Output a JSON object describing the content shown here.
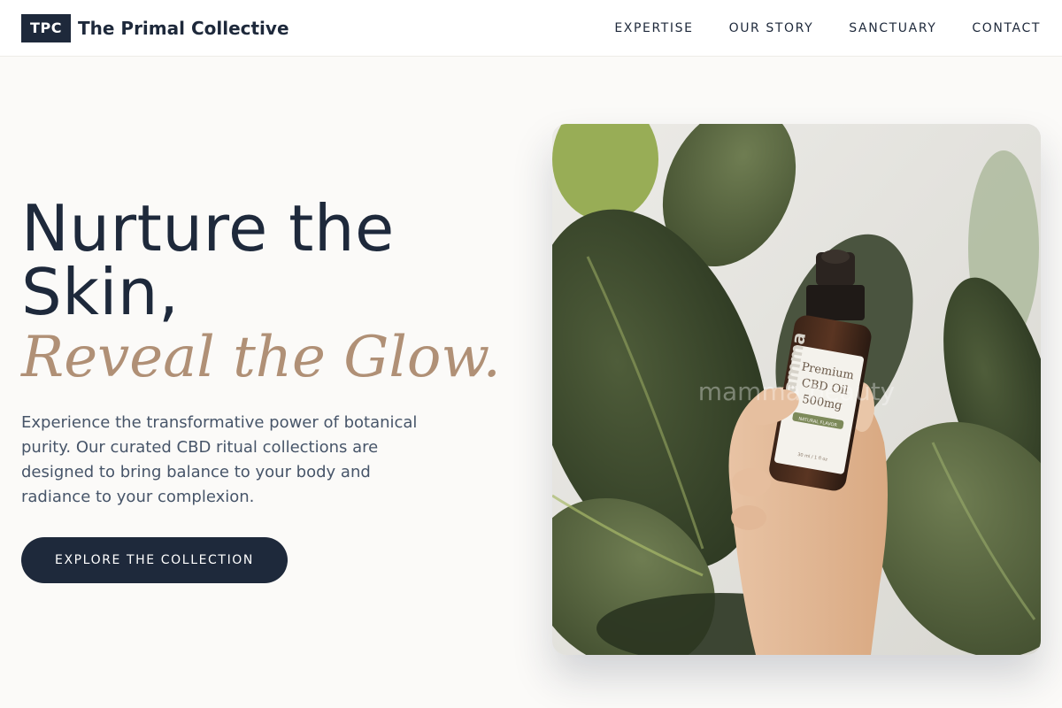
{
  "header": {
    "logo_text": "TPC",
    "brand_name": "The Primal Collective",
    "nav": [
      {
        "label": "EXPERTISE"
      },
      {
        "label": "OUR STORY"
      },
      {
        "label": "SANCTUARY"
      },
      {
        "label": "CONTACT"
      }
    ]
  },
  "hero": {
    "title_line1": "Nurture the",
    "title_line2": "Skin,",
    "accent": "Reveal the Glow.",
    "description": "Experience the transformative power of botanical purity. Our curated CBD ritual collections are designed to bring balance to your body and radiance to your complexion.",
    "cta_label": "EXPLORE THE COLLECTION"
  },
  "image": {
    "bottle_label_line1": "Premium",
    "bottle_label_line2": "CBD Oil",
    "bottle_label_line3": "500mg",
    "bottle_tag": "NATURAL FLAVOR",
    "bottle_brand": "mamma",
    "bottle_volume": "30 ml / 1 fl oz",
    "watermark": "mamma beauty"
  },
  "colors": {
    "primary": "#1e293b",
    "accent": "#b09076",
    "background": "#fbfaf8"
  }
}
